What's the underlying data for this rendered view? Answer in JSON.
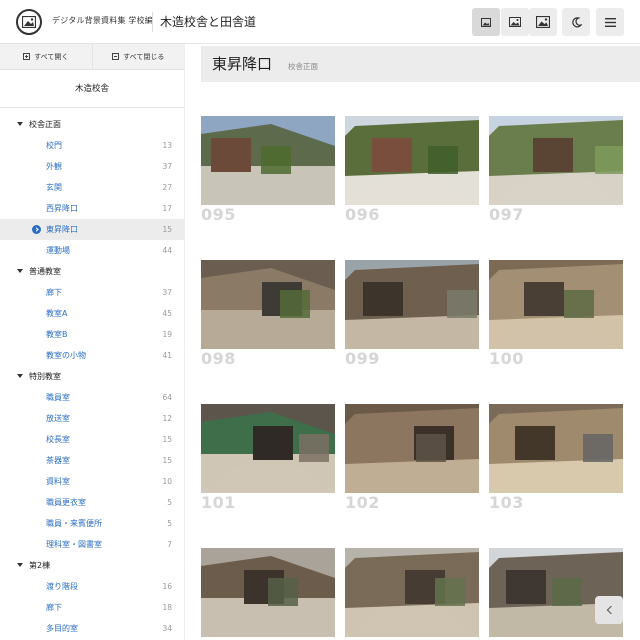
{
  "header": {
    "brand": "デジタル背景資料集 学校編",
    "site_title": "木造校舎と田舎道",
    "buttons": [
      "image-small-icon",
      "image-medium-icon",
      "image-large-icon",
      "moon-icon",
      "menu-icon"
    ]
  },
  "sidebar": {
    "expand_all": "すべて開く",
    "collapse_all": "すべて閉じる",
    "heading": "木造校舎",
    "groups": [
      {
        "label": "校舎正面",
        "items": [
          {
            "label": "校門",
            "count": "13"
          },
          {
            "label": "外観",
            "count": "37"
          },
          {
            "label": "玄関",
            "count": "27"
          },
          {
            "label": "西昇降口",
            "count": "17"
          },
          {
            "label": "東昇降口",
            "count": "15",
            "active": true
          },
          {
            "label": "運動場",
            "count": "44"
          }
        ]
      },
      {
        "label": "普通教室",
        "items": [
          {
            "label": "廊下",
            "count": "37"
          },
          {
            "label": "教室A",
            "count": "45"
          },
          {
            "label": "教室B",
            "count": "19"
          },
          {
            "label": "教室の小物",
            "count": "41"
          }
        ]
      },
      {
        "label": "特別教室",
        "items": [
          {
            "label": "職員室",
            "count": "64"
          },
          {
            "label": "放送室",
            "count": "12"
          },
          {
            "label": "校長室",
            "count": "15"
          },
          {
            "label": "茶器室",
            "count": "15"
          },
          {
            "label": "資料室",
            "count": "10"
          },
          {
            "label": "職員更衣室",
            "count": "5"
          },
          {
            "label": "職員・来賓便所",
            "count": "5"
          },
          {
            "label": "理科室・図書室",
            "count": "7"
          }
        ]
      },
      {
        "label": "第2棟",
        "items": [
          {
            "label": "渡り階段",
            "count": "16"
          },
          {
            "label": "廊下",
            "count": "18"
          },
          {
            "label": "多目的室",
            "count": "34"
          }
        ]
      }
    ]
  },
  "main": {
    "title": "東昇降口",
    "subtitle": "校舎正面",
    "thumbnails": [
      "095",
      "096",
      "097",
      "098",
      "099",
      "100",
      "101",
      "102",
      "103",
      "",
      "",
      ""
    ]
  },
  "colors": {
    "link": "#2b6fc4",
    "panel": "#ececec"
  }
}
